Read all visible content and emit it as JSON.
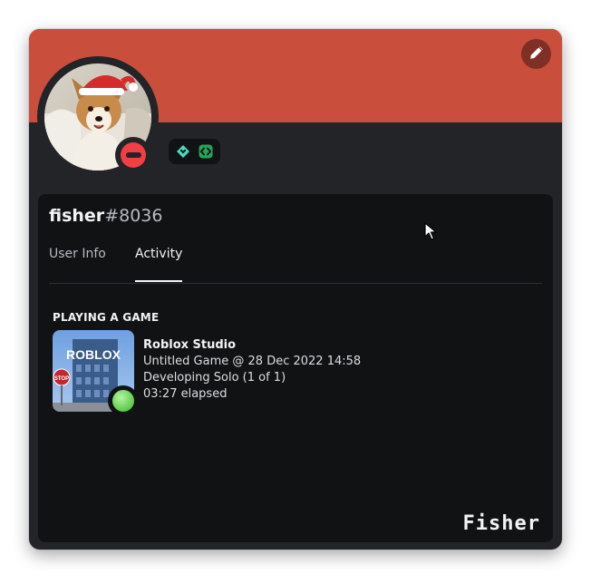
{
  "profile": {
    "username": "fisher",
    "discriminator": "#8036",
    "status": "do-not-disturb",
    "banner_color": "#c94f3c",
    "badges": [
      "hypesquad-balance-icon",
      "active-developer-icon"
    ]
  },
  "header": {
    "edit_icon": "pencil-icon"
  },
  "tabs": [
    {
      "label": "User Info",
      "active": false
    },
    {
      "label": "Activity",
      "active": true
    }
  ],
  "activity": {
    "section_title": "PLAYING A GAME",
    "game_art_text": "ROBLOX",
    "sign_text": "STOP",
    "name": "Roblox Studio",
    "details": "Untitled Game @ 28 Dec 2022 14:58",
    "state": "Developing Solo (1 of 1)",
    "elapsed": "03:27 elapsed"
  },
  "watermark": "Fisher",
  "colors": {
    "accent": "#c94f3c",
    "dnd": "#f23f43",
    "online_green": "#5cc94a"
  }
}
